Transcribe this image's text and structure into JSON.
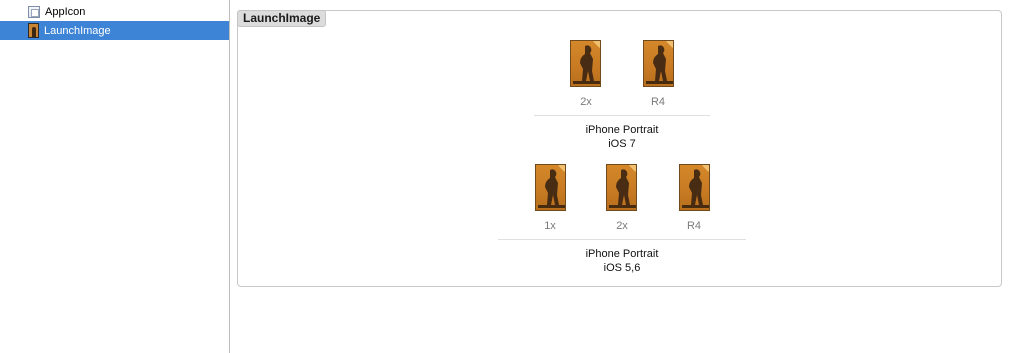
{
  "sidebar": {
    "items": [
      {
        "label": "AppIcon",
        "icon": "app-icon-set-icon",
        "selected": false
      },
      {
        "label": "LaunchImage",
        "icon": "launch-image-set-icon",
        "selected": true
      }
    ]
  },
  "panel": {
    "title": "LaunchImage",
    "groups": [
      {
        "device": "iPhone Portrait",
        "os": "iOS 7",
        "slots": [
          {
            "scale": "2x"
          },
          {
            "scale": "R4"
          }
        ]
      },
      {
        "device": "iPhone Portrait",
        "os": "iOS 5,6",
        "slots": [
          {
            "scale": "1x"
          },
          {
            "scale": "2x"
          },
          {
            "scale": "R4"
          }
        ]
      }
    ]
  },
  "colors": {
    "selection": "#3d84d6",
    "thumbnail": "#c98433"
  }
}
